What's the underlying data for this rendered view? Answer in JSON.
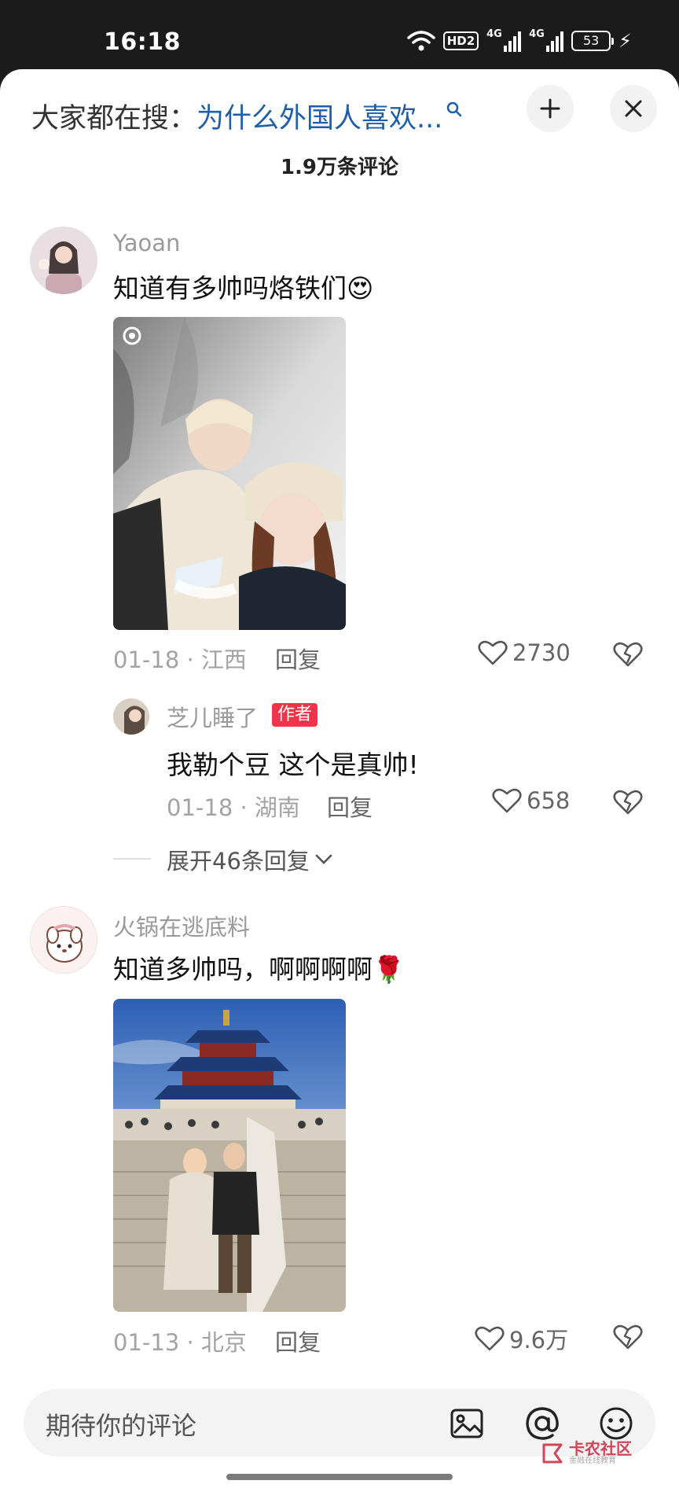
{
  "status_bar": {
    "time": "16:18",
    "hd_label": "HD2",
    "signal_1": "4G",
    "signal_2": "4G",
    "battery": "53"
  },
  "header": {
    "search_prefix": "大家都在搜：",
    "search_query": "为什么外国人喜欢...",
    "comment_count": "1.9万条评论"
  },
  "comments": [
    {
      "username": "Yaoan",
      "text": "知道有多帅吗烙铁们",
      "emoji": "😍",
      "date_location": "01-18 · 江西",
      "reply_label": "回复",
      "likes": "2730",
      "replies": [
        {
          "username": "芝儿睡了",
          "badge": "作者",
          "text": "我勒个豆 这个是真帅!",
          "date_location": "01-18 · 湖南",
          "reply_label": "回复",
          "likes": "658"
        }
      ],
      "expand_label": "展开46条回复"
    },
    {
      "username": "火锅在逃底料",
      "text": "知道多帅吗，啊啊啊啊",
      "emoji": "🌹",
      "date_location": "01-13 · 北京",
      "reply_label": "回复",
      "likes": "9.6万"
    }
  ],
  "input_bar": {
    "placeholder": "期待你的评论"
  },
  "watermark": {
    "main": "卡农社区",
    "sub": "金融在线教育"
  },
  "colors": {
    "link_blue": "#1f5ea8",
    "author_badge": "#f0344a",
    "meta_gray": "#a3a3a3"
  }
}
